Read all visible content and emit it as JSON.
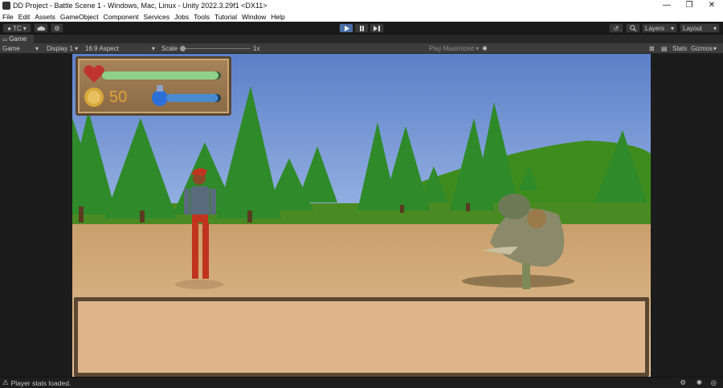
{
  "window": {
    "title": "DD Project - Battle Scene 1 - Windows, Mac, Linux - Unity 2022.3.29f1 <DX11>",
    "minimize": "—",
    "restore": "❐",
    "close": "✕"
  },
  "menu": [
    "File",
    "Edit",
    "Assets",
    "GameObject",
    "Component",
    "Services",
    "Jobs",
    "Tools",
    "Tutorial",
    "Window",
    "Help"
  ],
  "toolbar": {
    "account_label": "TC",
    "layers_label": "Layers",
    "layout_label": "Layout"
  },
  "tabs": {
    "game": "Game"
  },
  "gamebar": {
    "mode": "Game",
    "display": "Display 1",
    "aspect": "16:9 Aspect",
    "scale_label": "Scale",
    "scale_value": "1x",
    "play_maximized": "Play Maximized",
    "stats": "Stats",
    "gizmos": "Gizmos"
  },
  "hud": {
    "health_level": 0.98,
    "mana_level": 0.95,
    "coins": "50"
  },
  "status": {
    "message": "Player stats loaded."
  },
  "colors": {
    "sky": "#6b91d6",
    "sand": "#d9b486",
    "tree": "#2f8a2a",
    "hill": "#3f8c1e",
    "play_accent": "#4a6fa5"
  }
}
